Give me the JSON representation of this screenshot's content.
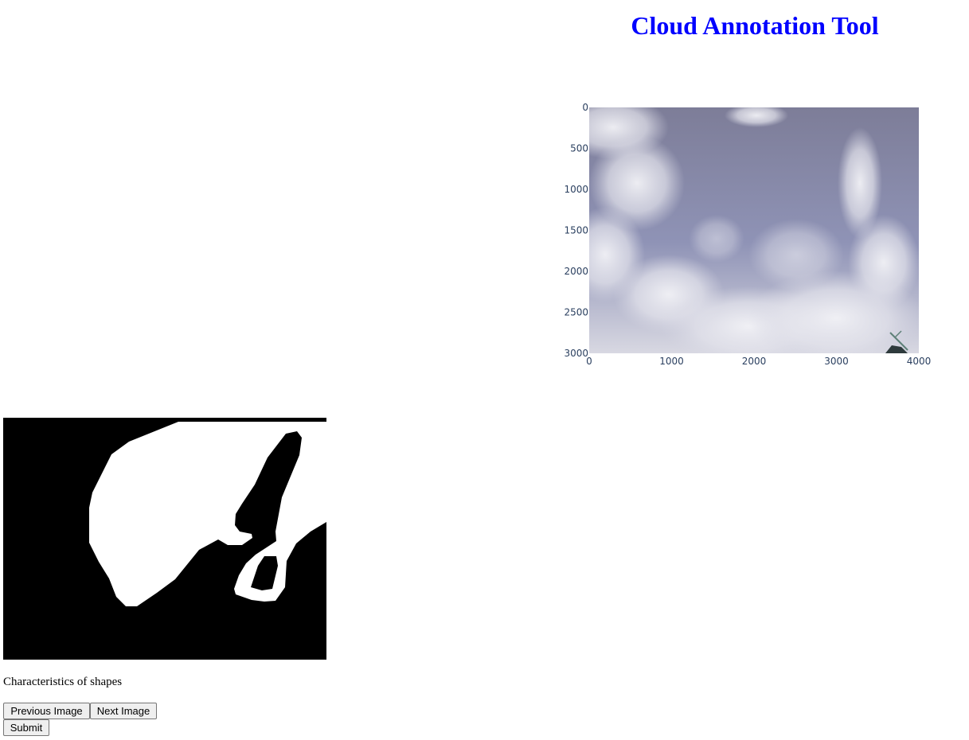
{
  "app": {
    "title": "Cloud Annotation Tool",
    "title_color": "#0000ff"
  },
  "image_viewer": {
    "content": "sky photo with scattered clouds, dark antenna structure bottom-right",
    "x_ticks": [
      "0",
      "1000",
      "2000",
      "3000",
      "4000"
    ],
    "y_ticks": [
      "0",
      "500",
      "1000",
      "1500",
      "2000",
      "2500",
      "3000"
    ],
    "x_range": [
      0,
      4000
    ],
    "y_range": [
      0,
      3000
    ],
    "y_reversed": true,
    "tick_color": "#2a3f5f"
  },
  "mask_panel": {
    "content": "binary segmentation mask, black and white shapes"
  },
  "caption": "Characteristics of shapes",
  "buttons": {
    "previous_label": "Previous Image",
    "next_label": "Next Image",
    "submit_label": "Submit"
  }
}
